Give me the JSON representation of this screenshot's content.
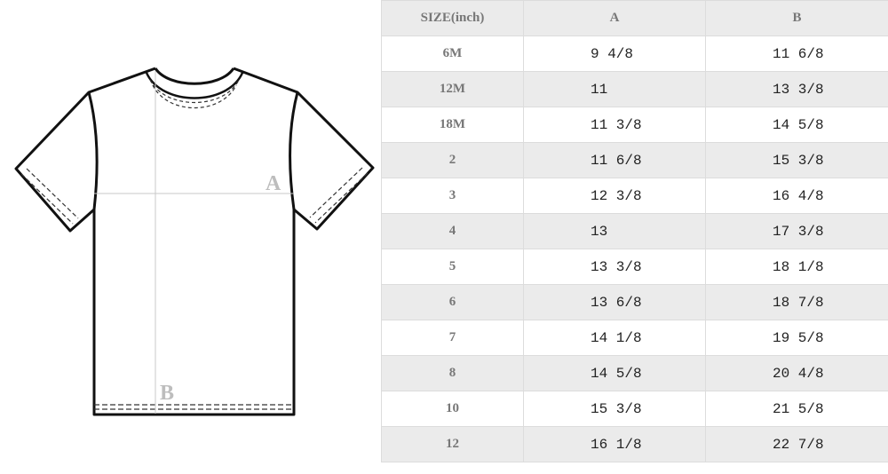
{
  "diagram": {
    "label_a": "A",
    "label_b": "B"
  },
  "table": {
    "headers": [
      "SIZE(inch)",
      "A",
      "B"
    ],
    "rows": [
      {
        "size": "6M",
        "a": "9 4/8",
        "b": "11 6/8"
      },
      {
        "size": "12M",
        "a": "11",
        "b": "13 3/8"
      },
      {
        "size": "18M",
        "a": "11 3/8",
        "b": "14 5/8"
      },
      {
        "size": "2",
        "a": "11 6/8",
        "b": "15 3/8"
      },
      {
        "size": "3",
        "a": "12 3/8",
        "b": "16 4/8"
      },
      {
        "size": "4",
        "a": "13",
        "b": "17 3/8"
      },
      {
        "size": "5",
        "a": "13 3/8",
        "b": "18 1/8"
      },
      {
        "size": "6",
        "a": "13 6/8",
        "b": "18 7/8"
      },
      {
        "size": "7",
        "a": "14 1/8",
        "b": "19 5/8"
      },
      {
        "size": "8",
        "a": "14 5/8",
        "b": "20 4/8"
      },
      {
        "size": "10",
        "a": "15 3/8",
        "b": "21 5/8"
      },
      {
        "size": "12",
        "a": "16 1/8",
        "b": "22 7/8"
      }
    ]
  }
}
